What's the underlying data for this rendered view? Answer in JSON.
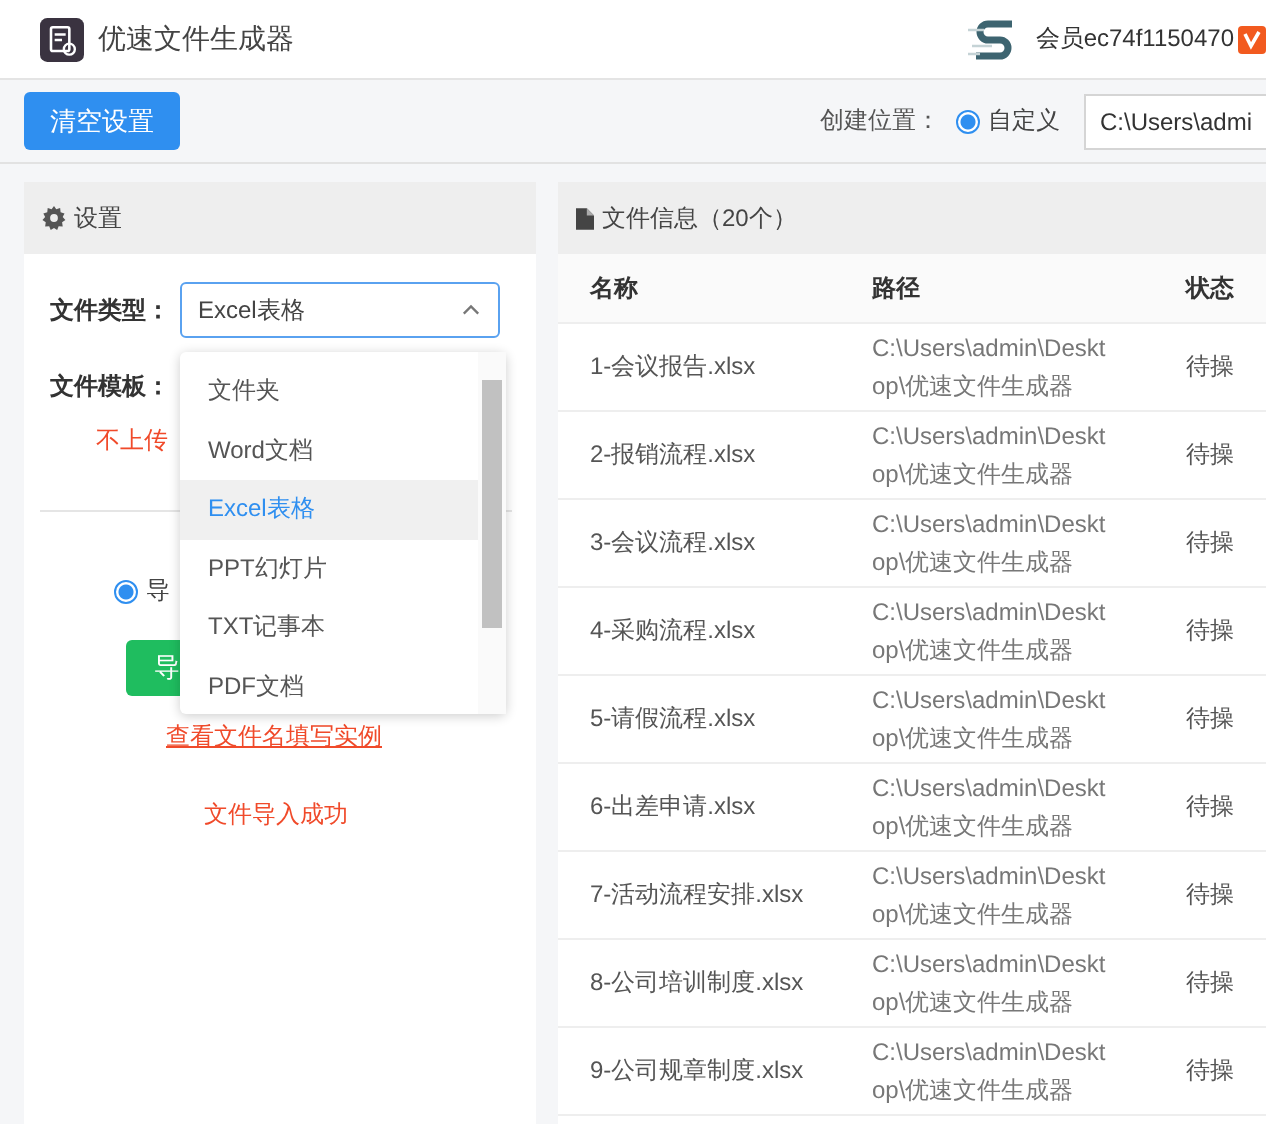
{
  "app": {
    "title": "优速文件生成器",
    "member": "会员ec74f1150470"
  },
  "toolbar": {
    "clear_button": "清空设置",
    "location_label": "创建位置：",
    "location_option": {
      "label": "自定义",
      "selected": true
    },
    "path_value": "C:\\Users\\admi"
  },
  "settings": {
    "title": "设置",
    "file_type_label": "文件类型：",
    "file_type_value": "Excel表格",
    "template_label": "文件模板：",
    "template_note": "不上传",
    "import_option": {
      "label": "导",
      "selected": true
    },
    "import_button": "导",
    "example_link": "查看文件名填写实例",
    "status_message": "文件导入成功",
    "dropdown": [
      {
        "label": "文件夹",
        "selected": false
      },
      {
        "label": "Word文档",
        "selected": false
      },
      {
        "label": "Excel表格",
        "selected": true
      },
      {
        "label": "PPT幻灯片",
        "selected": false
      },
      {
        "label": "TXT记事本",
        "selected": false
      },
      {
        "label": "PDF文档",
        "selected": false
      }
    ]
  },
  "files": {
    "title": "文件信息（20个）",
    "columns": [
      "名称",
      "路径",
      "状态"
    ],
    "rows": [
      {
        "name": "1-会议报告.xlsx",
        "path": "C:\\Users\\admin\\Desktop\\优速文件生成器",
        "status": "待操"
      },
      {
        "name": "2-报销流程.xlsx",
        "path": "C:\\Users\\admin\\Desktop\\优速文件生成器",
        "status": "待操"
      },
      {
        "name": "3-会议流程.xlsx",
        "path": "C:\\Users\\admin\\Desktop\\优速文件生成器",
        "status": "待操"
      },
      {
        "name": "4-采购流程.xlsx",
        "path": "C:\\Users\\admin\\Desktop\\优速文件生成器",
        "status": "待操"
      },
      {
        "name": "5-请假流程.xlsx",
        "path": "C:\\Users\\admin\\Desktop\\优速文件生成器",
        "status": "待操"
      },
      {
        "name": "6-出差申请.xlsx",
        "path": "C:\\Users\\admin\\Desktop\\优速文件生成器",
        "status": "待操"
      },
      {
        "name": "7-活动流程安排.xlsx",
        "path": "C:\\Users\\admin\\Desktop\\优速文件生成器",
        "status": "待操"
      },
      {
        "name": "8-公司培训制度.xlsx",
        "path": "C:\\Users\\admin\\Desktop\\优速文件生成器",
        "status": "待操"
      },
      {
        "name": "9-公司规章制度.xlsx",
        "path": "C:\\Users\\admin\\Desktop\\优速文件生成器",
        "status": "待操"
      }
    ]
  }
}
